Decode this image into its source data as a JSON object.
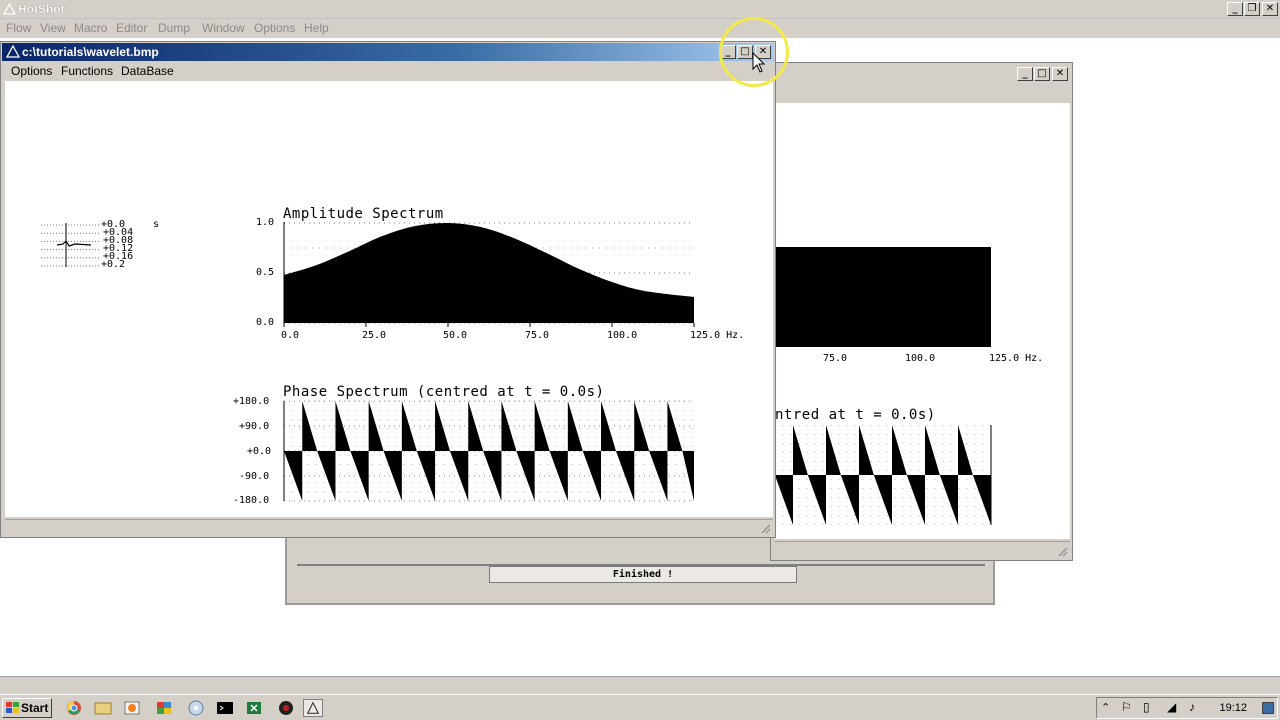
{
  "app": {
    "title": "HotShot",
    "menu": [
      "Flow",
      "View",
      "Macro",
      "Editor",
      "Dump",
      "Window",
      "Options",
      "Help"
    ]
  },
  "window_front": {
    "title": "c:\\tutorials\\wavelet.bmp",
    "menu": [
      "Options",
      "Functions",
      "DataBase"
    ]
  },
  "wavelet_trace": {
    "time_labels": [
      "+0.0",
      "+0.04",
      "+0.08",
      "+0.12",
      "+0.16",
      "+0.2"
    ],
    "unit": "s"
  },
  "amplitude_plot": {
    "title": "Amplitude Spectrum",
    "y_ticks": [
      "1.0",
      "0.5",
      "0.0"
    ],
    "x_ticks": [
      "0.0",
      "25.0",
      "50.0",
      "75.0",
      "100.0",
      "125.0 Hz."
    ]
  },
  "phase_plot": {
    "title": "Phase Spectrum (centred at t = 0.0s)",
    "y_ticks": [
      "+180.0",
      "+90.0",
      "+0.0",
      "-90.0",
      "-180.0"
    ]
  },
  "window_back": {
    "x_ticks": [
      "75.0",
      "100.0",
      "125.0 Hz."
    ],
    "phase_title_partial": "ntred at t = 0.0s)"
  },
  "dialog": {
    "status": "Finished !"
  },
  "taskbar": {
    "start": "Start",
    "clock": "19:12"
  },
  "chart_data": [
    {
      "type": "area",
      "title": "Amplitude Spectrum",
      "xlabel": "Hz.",
      "ylabel": "",
      "xlim": [
        0,
        125
      ],
      "ylim": [
        0,
        1
      ],
      "x": [
        0,
        10,
        20,
        30,
        40,
        50,
        60,
        70,
        80,
        90,
        100,
        110,
        125
      ],
      "values": [
        0.48,
        0.58,
        0.72,
        0.87,
        0.97,
        1.0,
        0.96,
        0.85,
        0.7,
        0.54,
        0.41,
        0.32,
        0.26
      ]
    },
    {
      "type": "area",
      "title": "Phase Spectrum (centred at t = 0.0s)",
      "xlabel": "",
      "ylabel": "",
      "ylim": [
        -180,
        180
      ],
      "cycles": 12,
      "description_values": "sawtooth phase wrapping between +180 and -180"
    }
  ],
  "colors": {
    "chrome": "#d4d0c8",
    "title_active_start": "#0a246a",
    "title_active_end": "#a6caf0",
    "cursor_highlight": "#f4e94a"
  }
}
